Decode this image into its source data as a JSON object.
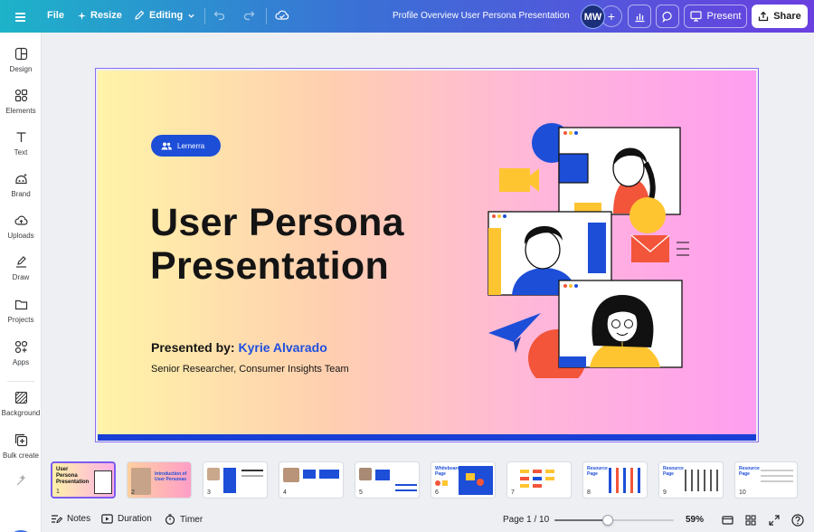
{
  "topbar": {
    "file_label": "File",
    "resize_label": "Resize",
    "editing_label": "Editing",
    "doc_title": "Profile Overview User Persona Presentation",
    "avatar_initials": "MW",
    "add_label": "+",
    "present_label": "Present",
    "share_label": "Share"
  },
  "sidebar": {
    "items": [
      {
        "label": "Design",
        "icon": "design-icon"
      },
      {
        "label": "Elements",
        "icon": "elements-icon"
      },
      {
        "label": "Text",
        "icon": "text-icon"
      },
      {
        "label": "Brand",
        "icon": "brand-icon"
      },
      {
        "label": "Uploads",
        "icon": "uploads-icon"
      },
      {
        "label": "Draw",
        "icon": "draw-icon"
      },
      {
        "label": "Projects",
        "icon": "projects-icon"
      },
      {
        "label": "Apps",
        "icon": "apps-icon"
      },
      {
        "label": "Background",
        "icon": "background-icon"
      },
      {
        "label": "Bulk create",
        "icon": "bulk-create-icon"
      }
    ]
  },
  "slide": {
    "brand_chip": "Lernerra",
    "title_line1": "User Persona",
    "title_line2": "Presentation",
    "presented_prefix": "Presented by: ",
    "presenter_name": "Kyrie Alvarado",
    "role": "Senior Researcher, Consumer Insights Team",
    "colors": {
      "accent_blue": "#1d4ed8",
      "accent_purple": "#7b5cf0",
      "accent_red": "#f2553a",
      "accent_yellow": "#ffc531"
    }
  },
  "thumbnails": [
    {
      "num": "1",
      "title": "User Persona Presentation"
    },
    {
      "num": "2",
      "title": "Introduction of User Personas"
    },
    {
      "num": "3",
      "title": ""
    },
    {
      "num": "4",
      "title": ""
    },
    {
      "num": "5",
      "title": ""
    },
    {
      "num": "6",
      "title": "Whiteboard Page"
    },
    {
      "num": "7",
      "title": ""
    },
    {
      "num": "8",
      "title": "Resource Page"
    },
    {
      "num": "9",
      "title": "Resource Page"
    },
    {
      "num": "10",
      "title": "Resource Page"
    }
  ],
  "bottombar": {
    "notes_label": "Notes",
    "duration_label": "Duration",
    "timer_label": "Timer",
    "page_indicator": "Page 1 / 10",
    "zoom_fraction": 0.45,
    "zoom_label": "59%"
  }
}
